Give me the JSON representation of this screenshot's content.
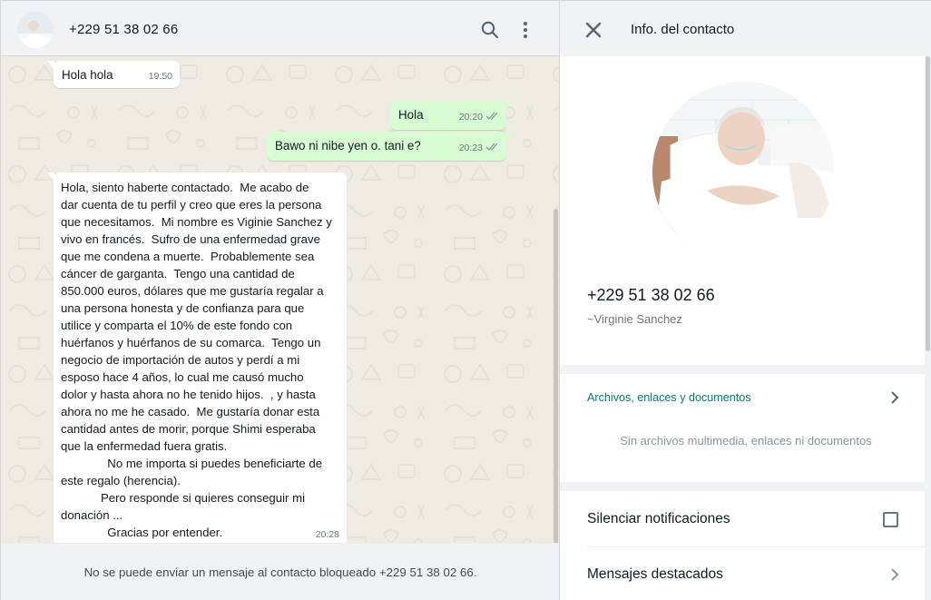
{
  "chat": {
    "contact_phone": "+229 51 38 02 66",
    "messages": [
      {
        "direction": "in",
        "text": "Hola hola",
        "time": "19:50"
      },
      {
        "direction": "out",
        "text": "Hola",
        "time": "20:20"
      },
      {
        "direction": "out",
        "text": "Bawo ni nibe yen o. tani e?",
        "time": "20:23"
      },
      {
        "direction": "in",
        "text": "Hola, siento haberte contactado.  Me acabo de\ndar cuenta de tu perfil y creo que eres la persona\nque necesitamos.  Mi nombre es Viginie Sanchez y\nvivo en francés.  Sufro de una enfermedad grave\nque me condena a muerte.  Probablemente sea\ncáncer de garganta.  Tengo una cantidad de\n850.000 euros, dólares que me gustaría regalar a\nuna persona honesta y de confianza para que\nutilice y comparta el 10% de este fondo con\nhuérfanos y huérfanos de su comarca.  Tengo un\nnegocio de importación de autos y perdí a mi\nesposo hace 4 años, lo cual me causó mucho\ndolor y hasta ahora no he tenido hijos.  , y hasta\nahora no me he casado.  Me gustaría donar esta\ncantidad antes de morir, porque Shimi esperaba\nque la enfermedad fuera gratis.\n              No me importa si puedes beneficiarte de\neste regalo (herencia).\n            Pero responde si quieres conseguir mi\ndonación ...\n              Gracias por entender.",
        "time": "20:28"
      }
    ],
    "blocked_notice": "No se puede enviar un mensaje al contacto bloqueado +229 51 38 02 66."
  },
  "info": {
    "title": "Info. del contacto",
    "phone": "+229 51 38 02 66",
    "name": "~Virginie Sanchez",
    "media_label": "Archivos, enlaces y documentos",
    "media_empty": "Sin archivos multimedia, enlaces ni documentos",
    "mute_label": "Silenciar notificaciones",
    "mute_checked": false,
    "starred_label": "Mensajes destacados"
  },
  "icons": {
    "search": "search-icon",
    "menu": "menu-dots-icon",
    "close": "close-icon",
    "chevron": "chevron-right-icon",
    "ticks": "double-check-icon"
  },
  "colors": {
    "outgoing_bubble": "#d9fdd3",
    "incoming_bubble": "#ffffff",
    "chat_background": "#efeae2",
    "accent": "#008069",
    "panel": "#f0f2f5"
  }
}
